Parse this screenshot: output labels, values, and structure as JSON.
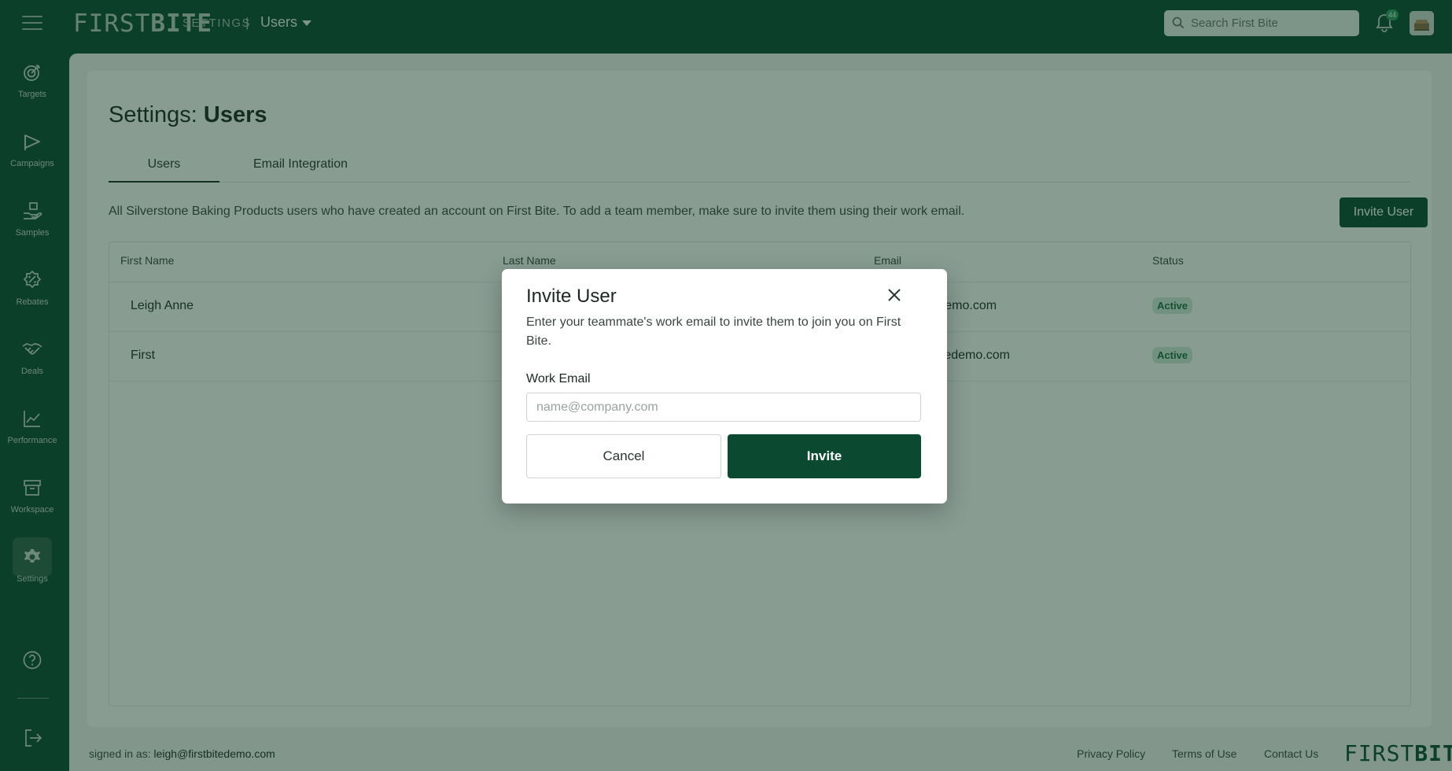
{
  "app": {
    "logo_prefix": "FIRST",
    "logo_suffix": "BITE",
    "breadcrumb_section": "SETTINGS",
    "breadcrumb_separator": "|",
    "breadcrumb_current": "Users",
    "search_placeholder": "Search First Bite",
    "notification_count": "44"
  },
  "sidebar": {
    "items": [
      {
        "label": "Targets",
        "icon": "target-icon"
      },
      {
        "label": "Campaigns",
        "icon": "megaphone-icon"
      },
      {
        "label": "Samples",
        "icon": "hand-box-icon"
      },
      {
        "label": "Rebates",
        "icon": "percent-badge-icon"
      },
      {
        "label": "Deals",
        "icon": "handshake-icon"
      },
      {
        "label": "Performance",
        "icon": "line-chart-icon"
      },
      {
        "label": "Workspace",
        "icon": "archive-box-icon"
      },
      {
        "label": "Settings",
        "icon": "gear-icon",
        "active": true
      }
    ]
  },
  "page": {
    "title_prefix": "Settings:",
    "title_bold": "Users",
    "tabs": [
      {
        "label": "Users",
        "active": true
      },
      {
        "label": "Email Integration",
        "active": false
      }
    ],
    "description": "All Silverstone Baking Products users who have created an account on First Bite. To add a team member, make sure to invite them using their work email.",
    "invite_button": "Invite User",
    "table": {
      "columns": [
        "First Name",
        "Last Name",
        "Email",
        "Status"
      ],
      "rows": [
        {
          "first": "Leigh Anne",
          "last": "",
          "email": "tedemo.com",
          "status": "Active"
        },
        {
          "first": "First",
          "last": "",
          "email": "tbitedemo.com",
          "status": "Active"
        }
      ]
    }
  },
  "footer": {
    "signed_in_label": "signed in as:",
    "signed_in_email": "leigh@firstbitedemo.com",
    "links": [
      "Privacy Policy",
      "Terms of Use",
      "Contact Us"
    ],
    "logo_prefix": "FIRST",
    "logo_suffix": "BITE"
  },
  "modal": {
    "title": "Invite User",
    "subtitle": "Enter your teammate's work email to invite them to join you on First Bite.",
    "field_label": "Work Email",
    "field_placeholder": "name@company.com",
    "field_value": "",
    "cancel_label": "Cancel",
    "invite_label": "Invite"
  },
  "colors": {
    "brand": "#0b4a30",
    "badge_bg": "#cfe6d7",
    "badge_text": "#1c6b3f"
  }
}
